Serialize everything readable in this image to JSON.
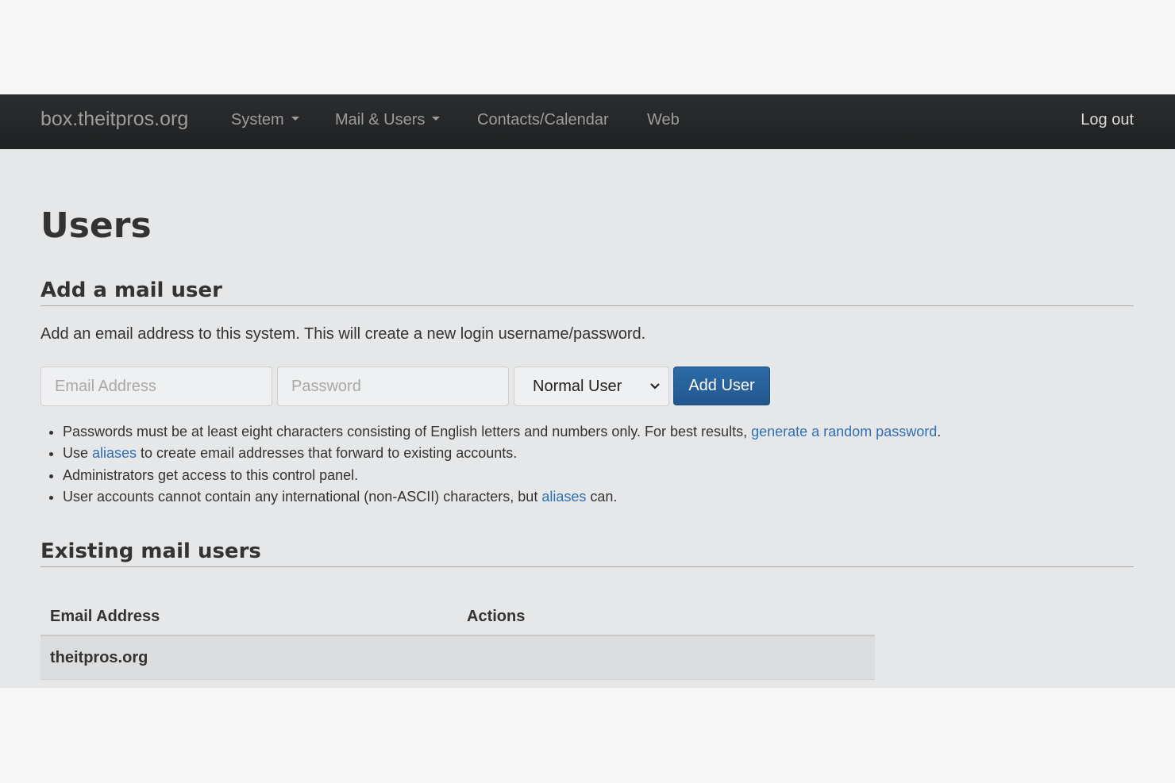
{
  "navbar": {
    "brand": "box.theitpros.org",
    "items": [
      {
        "label": "System",
        "dropdown": true
      },
      {
        "label": "Mail & Users",
        "dropdown": true
      },
      {
        "label": "Contacts/Calendar",
        "dropdown": false
      },
      {
        "label": "Web",
        "dropdown": false
      }
    ],
    "logout": "Log out"
  },
  "page": {
    "title": "Users"
  },
  "add_user": {
    "heading": "Add a mail user",
    "description": "Add an email address to this system. This will create a new login username/password.",
    "email_placeholder": "Email Address",
    "password_placeholder": "Password",
    "privilege_selected": "Normal User",
    "submit_label": "Add User",
    "notes": [
      {
        "before": "Passwords must be at least eight characters consisting of English letters and numbers only. For best results, ",
        "link": "generate a random password",
        "after": "."
      },
      {
        "before": "Use ",
        "link": "aliases",
        "after": " to create email addresses that forward to existing accounts."
      },
      {
        "before": "Administrators get access to this control panel.",
        "link": "",
        "after": ""
      },
      {
        "before": "User accounts cannot contain any international (non-ASCII) characters, but ",
        "link": "aliases",
        "after": " can."
      }
    ]
  },
  "existing_users": {
    "heading": "Existing mail users",
    "columns": [
      "Email Address",
      "Actions"
    ],
    "rows": [
      {
        "domain": "theitpros.org",
        "actions": ""
      }
    ]
  },
  "colors": {
    "navbar_bg": "#222222",
    "primary_button": "#28609a",
    "link": "#2f6fb1",
    "page_bg": "#e6e7e8"
  }
}
